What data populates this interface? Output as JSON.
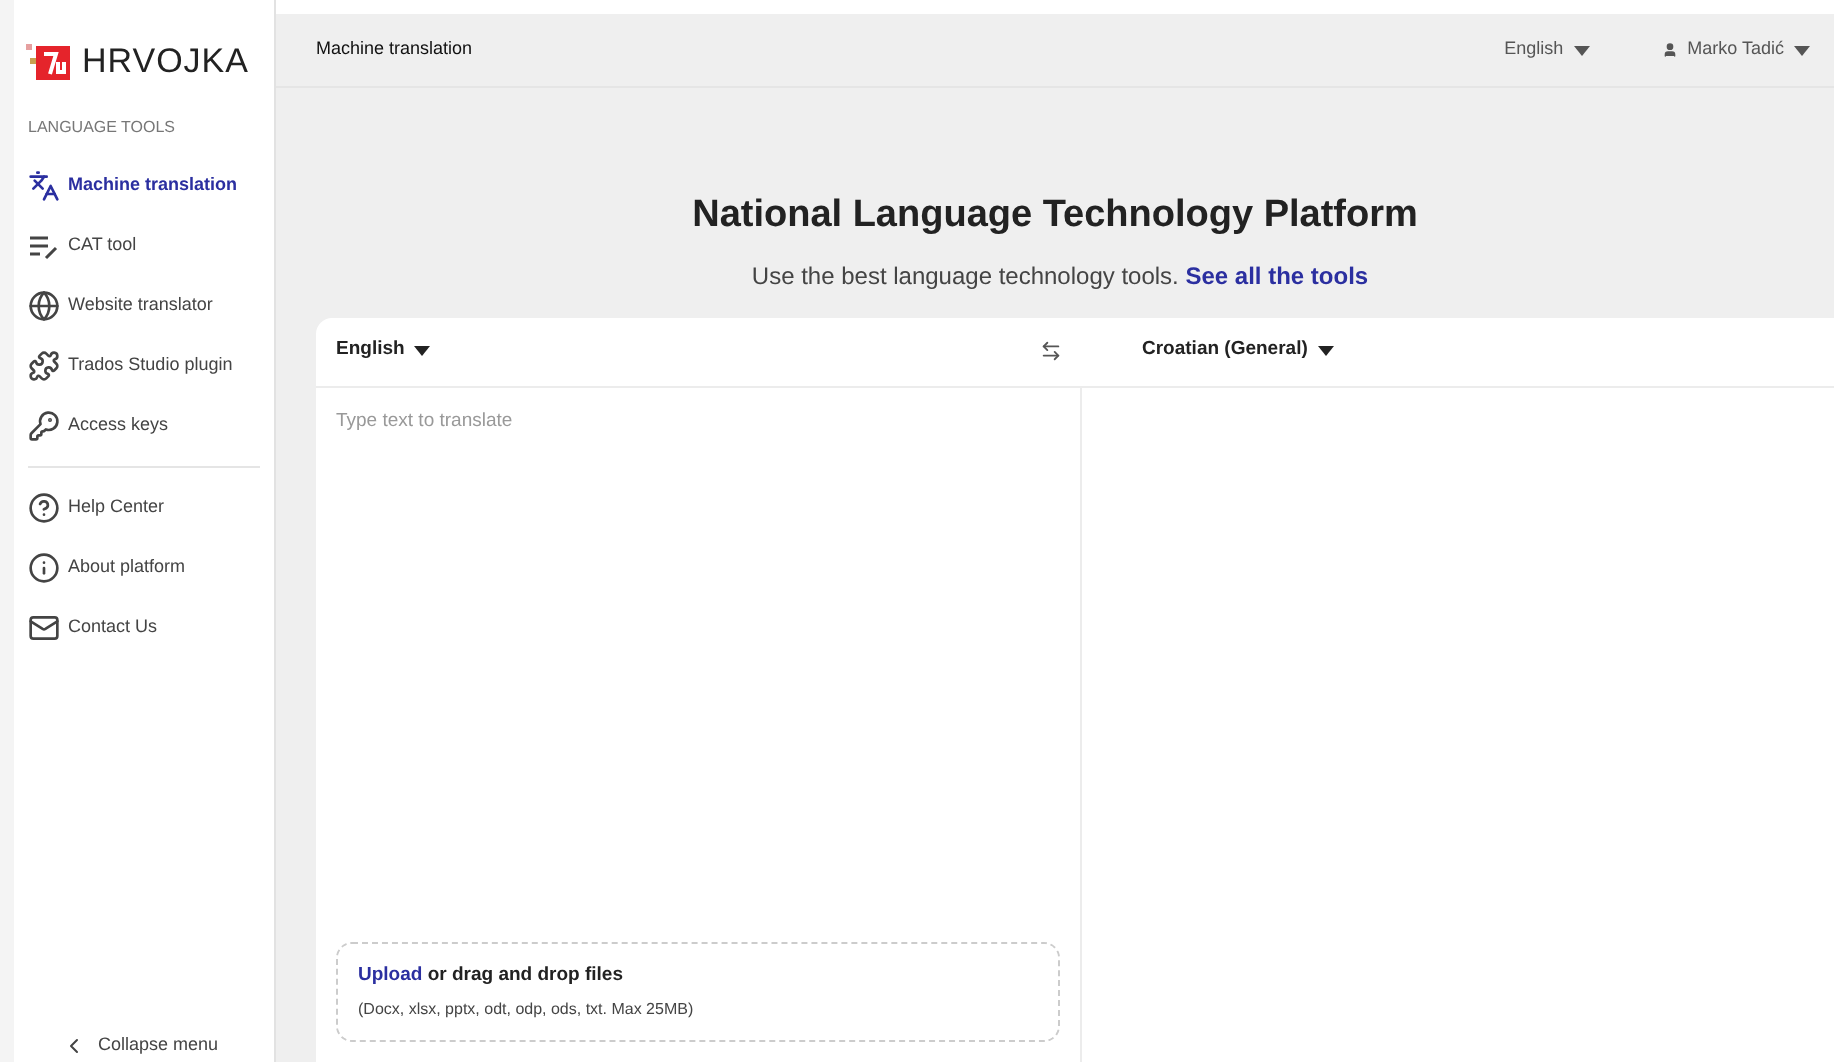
{
  "brand": {
    "name": "HRVOJKA"
  },
  "sidebar": {
    "section": "LANGUAGE TOOLS",
    "items": [
      {
        "label": "Machine translation",
        "selected": true
      },
      {
        "label": "CAT tool",
        "selected": false
      },
      {
        "label": "Website translator",
        "selected": false
      },
      {
        "label": "Trados Studio plugin",
        "selected": false
      },
      {
        "label": "Access keys",
        "selected": false
      }
    ],
    "help_items": [
      {
        "label": "Help Center"
      },
      {
        "label": "About platform"
      },
      {
        "label": "Contact Us"
      }
    ],
    "collapse": "Collapse menu"
  },
  "header": {
    "title": "Machine translation",
    "language": "English",
    "user": "Marko Tadić"
  },
  "hero": {
    "title": "National Language Technology Platform",
    "subtitle": "Use the best language technology tools.",
    "link": "See all the tools"
  },
  "translator": {
    "source_language": "English",
    "target_language": "Croatian (General)",
    "placeholder": "Type text to translate",
    "upload": {
      "link": "Upload",
      "text": "or drag and drop files",
      "hint": "(Docx, xlsx, pptx, odt, odp, ods, txt. Max 25MB)"
    }
  }
}
